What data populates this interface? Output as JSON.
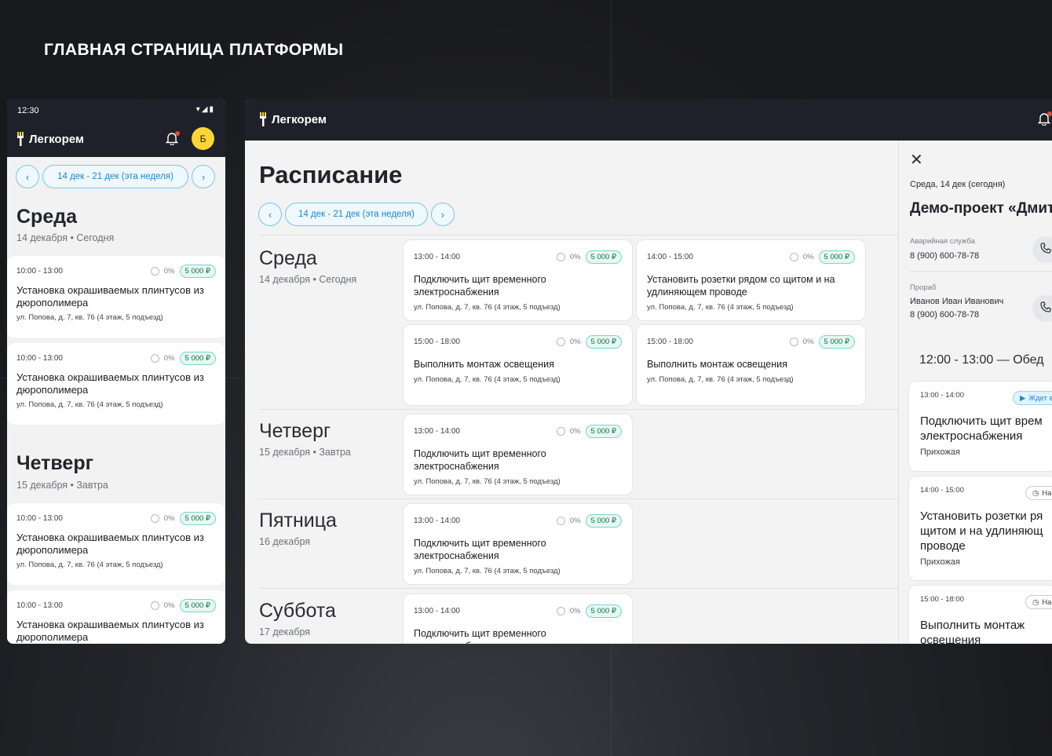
{
  "heading": "ГЛАВНАЯ СТРАНИЦА ПЛАТФОРМЫ",
  "brand": "Легкорем",
  "colors": {
    "accent": "#1a8acb",
    "brand_yellow": "#fcd535",
    "dark_bar": "#1e2129",
    "price_bg": "#e7f8f0"
  },
  "mobile": {
    "status_time": "12:30",
    "status_icons": "▾◢▮",
    "avatar": "Б",
    "week": "14 дек - 21 дек (эта неделя)",
    "days": [
      {
        "name": "Среда",
        "sub": "14 декабря • Сегодня",
        "cards": [
          {
            "time": "10:00 - 13:00",
            "pct": "0%",
            "price": "5 000 ₽",
            "title": "Установка окрашиваемых плинтусов из дюрополимера",
            "address": "ул. Попова, д. 7, кв. 76 (4 этаж, 5 подъезд)"
          },
          {
            "time": "10:00 - 13:00",
            "pct": "0%",
            "price": "5 000 ₽",
            "title": "Установка окрашиваемых плинтусов из дюрополимера",
            "address": "ул. Попова, д. 7, кв. 76 (4 этаж, 5 подъезд)"
          }
        ]
      },
      {
        "name": "Четверг",
        "sub": "15 декабря • Завтра",
        "cards": [
          {
            "time": "10:00 - 13:00",
            "pct": "0%",
            "price": "5 000 ₽",
            "title": "Установка окрашиваемых плинтусов из дюрополимера",
            "address": "ул. Попова, д. 7, кв. 76 (4 этаж, 5 подъезд)"
          },
          {
            "time": "10:00 - 13:00",
            "pct": "0%",
            "price": "5 000 ₽",
            "title": "Установка окрашиваемых плинтусов из дюрополимера",
            "address": ""
          }
        ]
      }
    ]
  },
  "desktop": {
    "title": "Расписание",
    "week": "14 дек - 21 дек (эта неделя)",
    "days": [
      {
        "name": "Среда",
        "sub": "14 декабря • Сегодня",
        "cards": [
          {
            "time": "13:00 - 14:00",
            "pct": "0%",
            "price": "5 000 ₽",
            "title": "Подключить щит временного электроснабжения",
            "address": "ул. Попова, д. 7, кв. 76 (4 этаж, 5 подъезд)"
          },
          {
            "time": "14:00 - 15:00",
            "pct": "0%",
            "price": "5 000 ₽",
            "title": "Установить розетки рядом со щитом и на удлиняющем проводе",
            "address": "ул. Попова, д. 7, кв. 76 (4 этаж, 5 подъезд)"
          },
          {
            "time": "15:00 - 18:00",
            "pct": "0%",
            "price": "5 000 ₽",
            "title": "Выполнить монтаж освещения",
            "address": "ул. Попова, д. 7, кв. 76 (4 этаж, 5 подъезд)"
          },
          {
            "time": "15:00 - 18:00",
            "pct": "0%",
            "price": "5 000 ₽",
            "title": "Выполнить монтаж освещения",
            "address": "ул. Попова, д. 7, кв. 76 (4 этаж, 5 подъезд)"
          }
        ]
      },
      {
        "name": "Четверг",
        "sub": "15 декабря • Завтра",
        "cards": [
          {
            "time": "13:00 - 14:00",
            "pct": "0%",
            "price": "5 000 ₽",
            "title": "Подключить щит временного электроснабжения",
            "address": "ул. Попова, д. 7, кв. 76 (4 этаж, 5 подъезд)"
          }
        ]
      },
      {
        "name": "Пятница",
        "sub": "16 декабря",
        "cards": [
          {
            "time": "13:00 - 14:00",
            "pct": "0%",
            "price": "5 000 ₽",
            "title": "Подключить щит временного электроснабжения",
            "address": "ул. Попова, д. 7, кв. 76 (4 этаж, 5 подъезд)"
          }
        ]
      },
      {
        "name": "Суббота",
        "sub": "17 декабря",
        "cards": [
          {
            "time": "13:00 - 14:00",
            "pct": "0%",
            "price": "5 000 ₽",
            "title": "Подключить щит временного электроснабжения",
            "address": ""
          }
        ]
      }
    ]
  },
  "panel": {
    "date": "Среда, 14 дек (сегодня)",
    "title": "Демо-проект «Дмит",
    "contacts": [
      {
        "label": "Аварийная служба",
        "lines": [
          "8 (900) 600-78-78"
        ]
      },
      {
        "label": "Прораб",
        "lines": [
          "Иванов Иван Иванович",
          "8 (900) 600-78-78"
        ]
      }
    ],
    "lunch": "12:00 - 13:00 — Обед",
    "tasks": [
      {
        "time": "13:00 - 14:00",
        "badge": "Ждет в",
        "badge_icon": "play-icon",
        "title_lines": [
          "Подключить щит врем",
          "электроснабжения"
        ],
        "room": "Прихожая"
      },
      {
        "time": "14:00 - 15:00",
        "badge": "На",
        "badge_icon": "clock-icon",
        "title_lines": [
          "Установить розетки ря",
          "щитом и на удлиняющ",
          "проводе"
        ],
        "room": "Прихожая"
      },
      {
        "time": "15:00 - 18:00",
        "badge": "На",
        "badge_icon": "clock-icon",
        "title_lines": [
          "Выполнить монтаж",
          "освещения"
        ],
        "room": ""
      }
    ]
  }
}
